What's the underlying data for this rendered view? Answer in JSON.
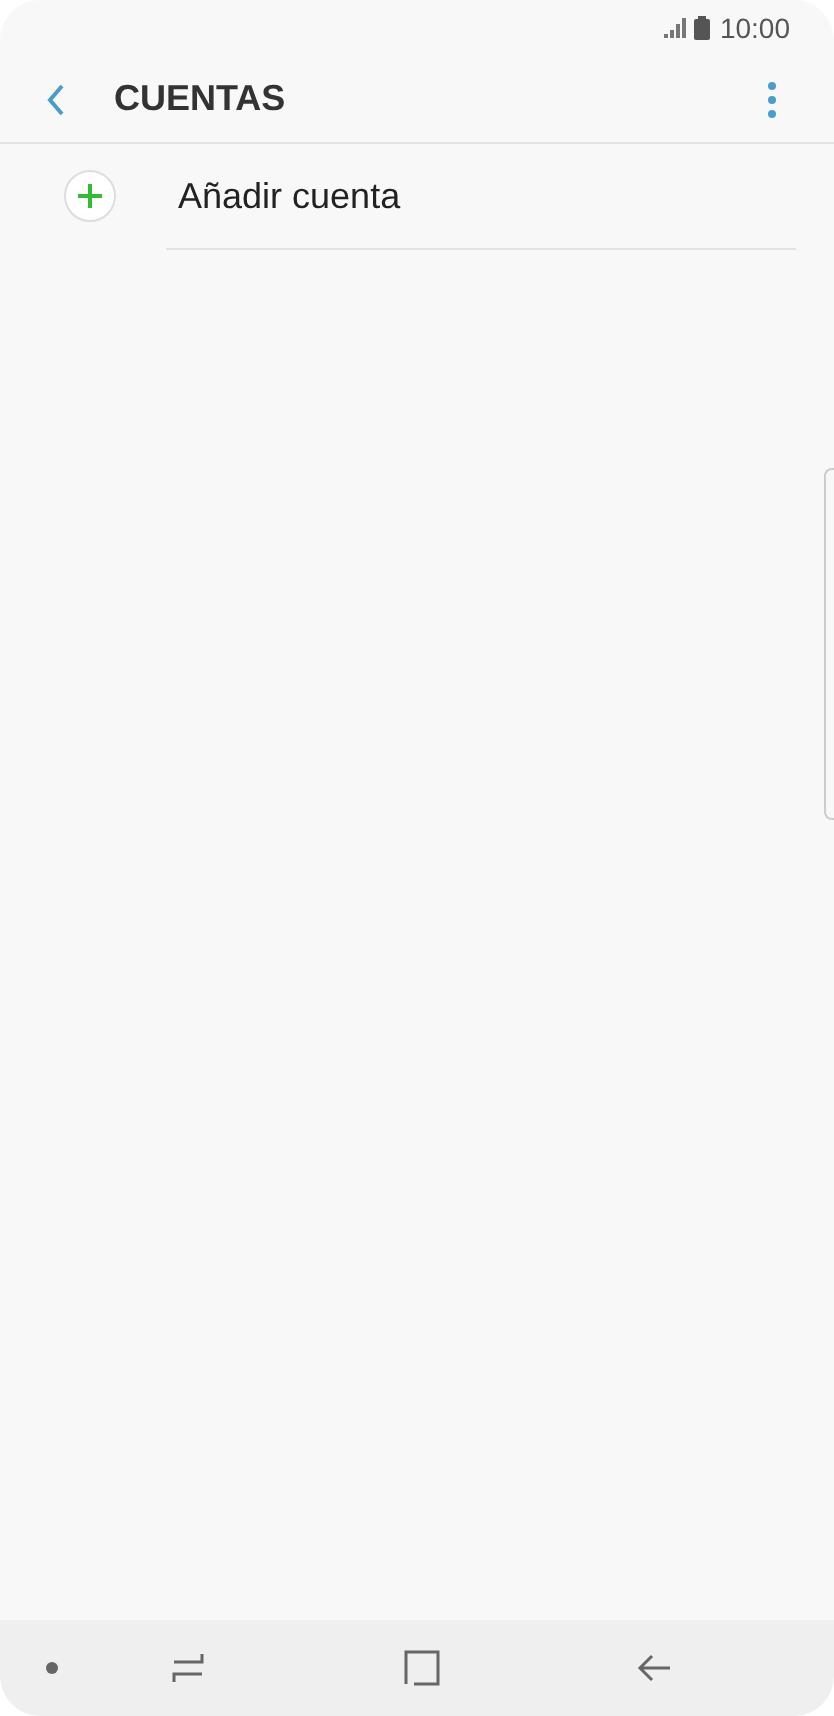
{
  "status_bar": {
    "time": "10:00"
  },
  "header": {
    "title": "CUENTAS"
  },
  "items": [
    {
      "label": "Añadir cuenta"
    }
  ]
}
